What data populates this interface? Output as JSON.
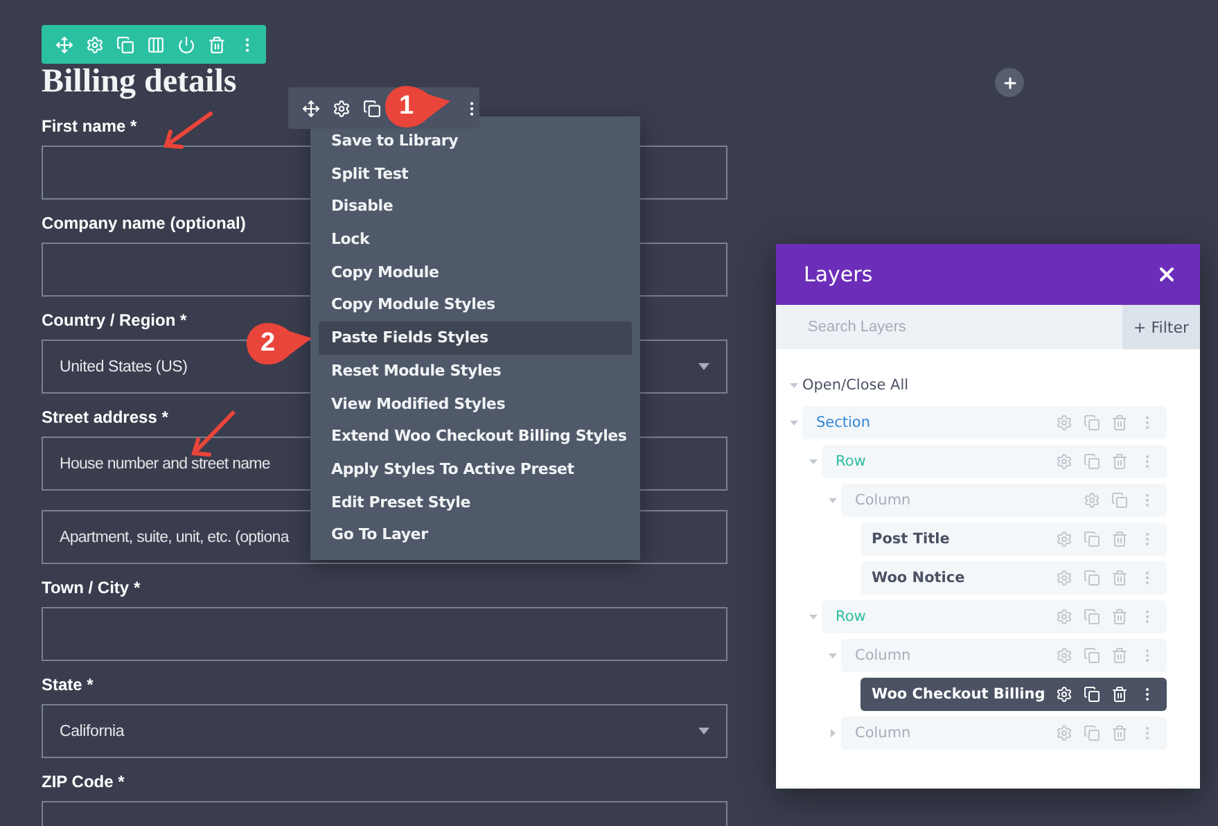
{
  "form": {
    "heading": "Billing details",
    "fields": [
      {
        "kind": "text",
        "label": "First name *"
      },
      {
        "kind": "text",
        "label": "Company name (optional)"
      },
      {
        "kind": "select",
        "label": "Country / Region *",
        "value": "United States (US)"
      },
      {
        "kind": "text",
        "label": "Street address *",
        "placeholder": "House number and street name",
        "extra_inputs": [
          {
            "placeholder": "Apartment, suite, unit, etc. (optiona"
          }
        ]
      },
      {
        "kind": "text",
        "label": "Town / City *"
      },
      {
        "kind": "select",
        "label": "State *",
        "value": "California"
      },
      {
        "kind": "text",
        "label": "ZIP Code *"
      }
    ]
  },
  "context_menu": {
    "items": [
      {
        "label": "Save to Library",
        "selected": false
      },
      {
        "label": "Split Test",
        "selected": false
      },
      {
        "label": "Disable",
        "selected": false
      },
      {
        "label": "Lock",
        "selected": false
      },
      {
        "label": "Copy Module",
        "selected": false
      },
      {
        "label": "Copy Module Styles",
        "selected": false
      },
      {
        "label": "Paste Fields Styles",
        "selected": true
      },
      {
        "label": "Reset Module Styles",
        "selected": false
      },
      {
        "label": "View Modified Styles",
        "selected": false
      },
      {
        "label": "Extend Woo Checkout Billing Styles",
        "selected": false
      },
      {
        "label": "Apply Styles To Active Preset",
        "selected": false
      },
      {
        "label": "Edit Preset Style",
        "selected": false
      },
      {
        "label": "Go To Layer",
        "selected": false
      }
    ]
  },
  "callouts": [
    {
      "label": "1"
    },
    {
      "label": "2"
    }
  ],
  "layers": {
    "title": "Layers",
    "search": {
      "placeholder": "Search Layers"
    },
    "filter_button": "+ Filter",
    "open_close_all": {
      "label": "Open/Close All",
      "expanded": true
    },
    "tree": [
      {
        "kind": "section",
        "label": "Section",
        "expanded": true,
        "selected": false,
        "deletable": true,
        "children": [
          {
            "kind": "row",
            "label": "Row",
            "expanded": true,
            "selected": false,
            "deletable": true,
            "children": [
              {
                "kind": "column",
                "label": "Column",
                "expanded": true,
                "selected": false,
                "deletable": false,
                "children": [
                  {
                    "kind": "module",
                    "label": "Post Title",
                    "selected": false,
                    "deletable": true
                  },
                  {
                    "kind": "module",
                    "label": "Woo Notice",
                    "selected": false,
                    "deletable": true
                  }
                ]
              }
            ]
          },
          {
            "kind": "row",
            "label": "Row",
            "expanded": true,
            "selected": false,
            "deletable": true,
            "children": [
              {
                "kind": "column",
                "label": "Column",
                "expanded": true,
                "selected": false,
                "deletable": true,
                "children": [
                  {
                    "kind": "module",
                    "label": "Woo Checkout Billing",
                    "selected": true,
                    "deletable": true
                  }
                ]
              },
              {
                "kind": "column",
                "label": "Column",
                "expanded": false,
                "selected": false,
                "deletable": true
              }
            ]
          }
        ]
      }
    ]
  }
}
